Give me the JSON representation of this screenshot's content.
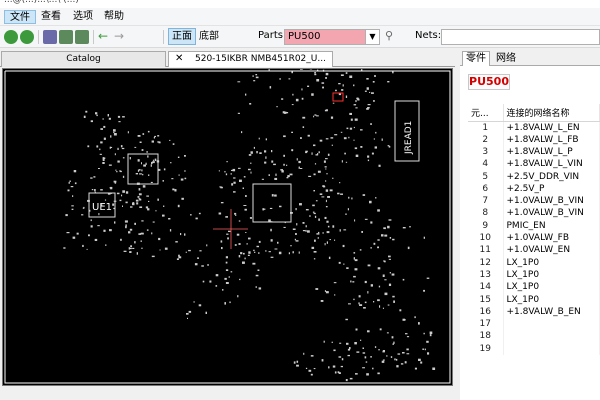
{
  "window": {
    "title": "...@(...)...\\...\\ (...)"
  },
  "menu": {
    "items": [
      "文件",
      "查看",
      "选项",
      "帮助"
    ]
  },
  "toolbar": {
    "front_label": "正面",
    "back_label": "底部",
    "parts_label": "Parts:",
    "parts_value": "PU500",
    "nets_label": "Nets:",
    "nets_value": ""
  },
  "tabs": {
    "catalog": "Catalog",
    "board": "520-15IKBR NMB451R02_U..."
  },
  "board": {
    "labels": {
      "ue1": "UE1",
      "jread1": "JREAD1"
    }
  },
  "right_panel": {
    "tabs": [
      "零件",
      "网络"
    ],
    "part_name": "PU500",
    "columns": [
      "元...",
      "连接的网络名称"
    ],
    "rows": [
      {
        "n": "1",
        "net": "+1.8VALW_L_EN"
      },
      {
        "n": "2",
        "net": "+1.8VALW_L_FB"
      },
      {
        "n": "3",
        "net": "+1.8VALW_L_P"
      },
      {
        "n": "4",
        "net": "+1.8VALW_L_VIN"
      },
      {
        "n": "5",
        "net": "+2.5V_DDR_VIN"
      },
      {
        "n": "6",
        "net": "+2.5V_P"
      },
      {
        "n": "7",
        "net": "+1.0VALW_B_VIN"
      },
      {
        "n": "8",
        "net": "+1.0VALW_B_VIN"
      },
      {
        "n": "9",
        "net": "PMIC_EN"
      },
      {
        "n": "10",
        "net": "+1.0VALW_FB"
      },
      {
        "n": "11",
        "net": "+1.0VALW_EN"
      },
      {
        "n": "12",
        "net": "LX_1P0"
      },
      {
        "n": "13",
        "net": "LX_1P0"
      },
      {
        "n": "14",
        "net": "LX_1P0"
      },
      {
        "n": "15",
        "net": "LX_1P0"
      },
      {
        "n": "16",
        "net": "+1.8VALW_B_EN"
      },
      {
        "n": "17",
        "net": ""
      },
      {
        "n": "18",
        "net": ""
      },
      {
        "n": "19",
        "net": ""
      }
    ]
  },
  "colors": {
    "parts_highlight": "#f4a6b0",
    "part_name": "#d40000",
    "canvas_bg": "#000000",
    "board_outline": "#ffffff"
  }
}
